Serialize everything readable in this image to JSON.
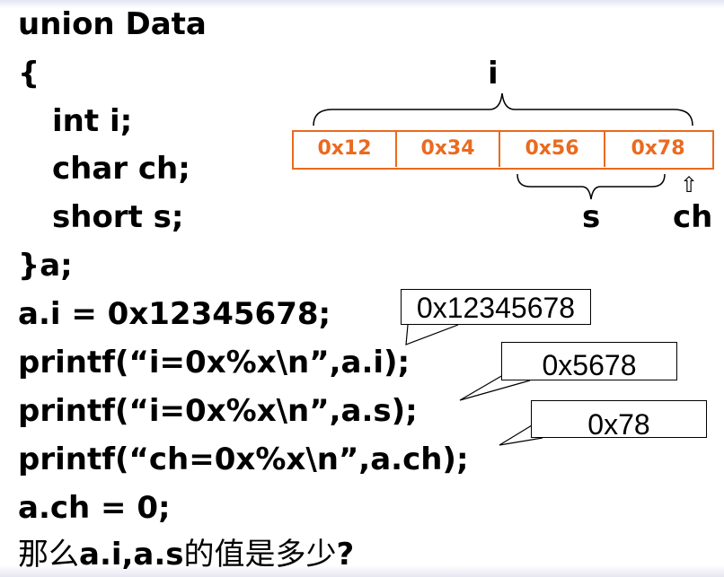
{
  "code": {
    "line1": "union Data",
    "line2": "{",
    "line3": "int i;",
    "line4": "char ch;",
    "line5": "short s;",
    "line6": "}a;",
    "line7": "a.i = 0x12345678;",
    "line8": "printf(“i=0x%x\\n”,a.i);",
    "line9": "printf(“i=0x%x\\n”,a.s);",
    "line10": "printf(“ch=0x%x\\n”,a.ch);",
    "line11": "a.ch = 0;"
  },
  "question": {
    "prefix": "那么",
    "vars": "a.i,a.s",
    "suffix": "的值是多少",
    "mark": "?"
  },
  "diagram": {
    "bytes": [
      "0x12",
      "0x34",
      "0x56",
      "0x78"
    ],
    "label_i": "i",
    "label_s": "s",
    "label_ch": "ch",
    "arrow": "⇧",
    "accent_color": "#ea6a1e"
  },
  "callouts": {
    "ai": "0x12345678",
    "as": "0x5678",
    "ach": "0x78"
  }
}
